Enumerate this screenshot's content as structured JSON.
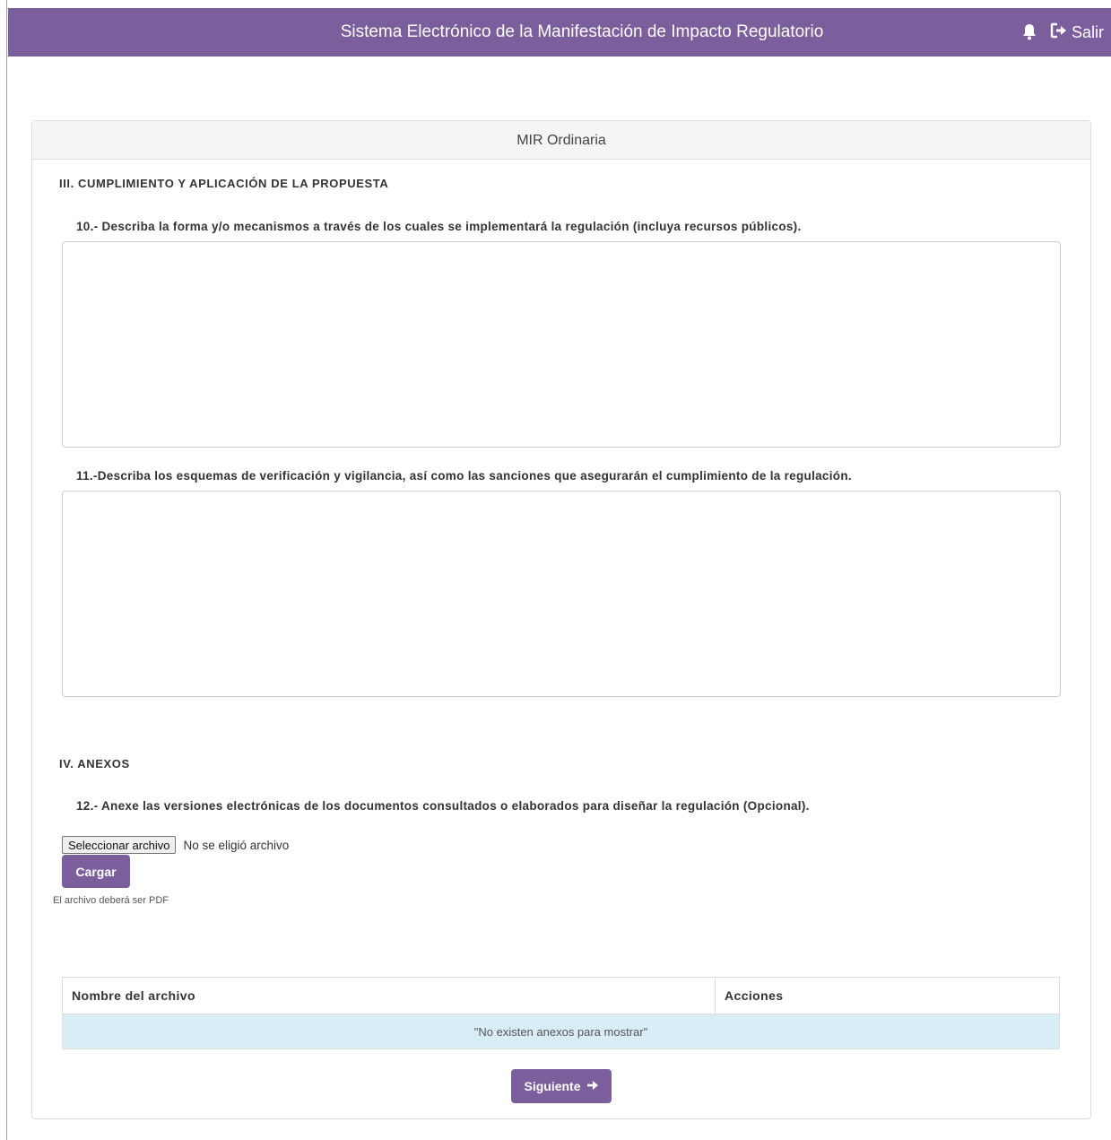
{
  "header": {
    "title": "Sistema Electrónico de la Manifestación de Impacto Regulatorio",
    "logout_label": "Salir",
    "brand_color": "#7b5e9c"
  },
  "panel": {
    "heading": "MIR Ordinaria"
  },
  "section3": {
    "title": "III. CUMPLIMIENTO Y APLICACIÓN DE LA PROPUESTA",
    "q10": {
      "label": "10.- Describa la forma y/o mecanismos a través de los cuales se implementará la regulación (incluya recursos públicos).",
      "value": ""
    },
    "q11": {
      "label": "11.-Describa los esquemas de verificación y vigilancia, así como las sanciones que asegurarán el cumplimiento de la regulación.",
      "value": ""
    }
  },
  "section4": {
    "title": "IV. ANEXOS",
    "q12": {
      "label": "12.- Anexe las versiones electrónicas de los documentos consultados o elaborados para diseñar la regulación (Opcional)."
    },
    "file_button_label": "Seleccionar archivo",
    "file_status": "No se eligió archivo",
    "upload_label": "Cargar",
    "hint": "El archivo deberá ser PDF",
    "table": {
      "columns": [
        "Nombre del archivo",
        "Acciones"
      ],
      "empty_message": "\"No existen anexos para mostrar\""
    }
  },
  "footer": {
    "next_label": "Siguiente"
  },
  "icons": {
    "bell": "bell-icon",
    "logout": "logout-icon",
    "next": "arrow-right-icon"
  }
}
